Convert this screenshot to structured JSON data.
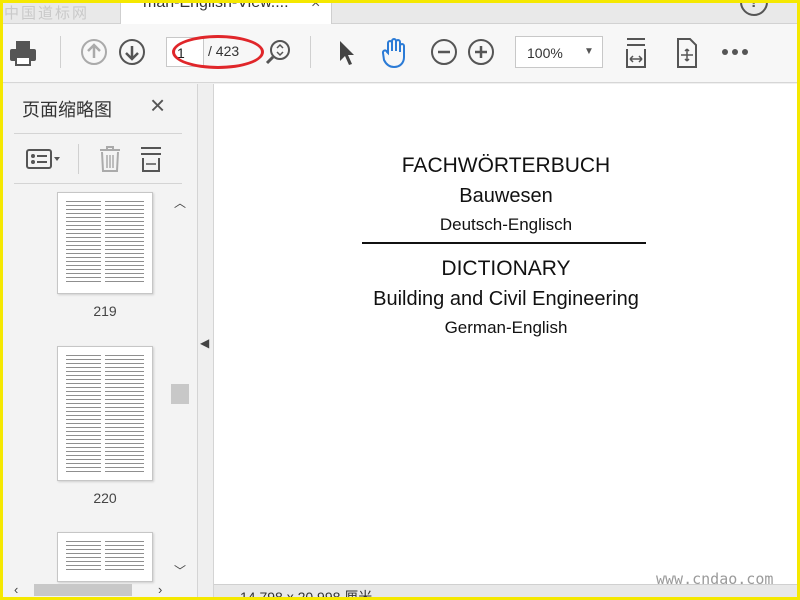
{
  "watermarks": {
    "top": "中国道标网",
    "bottom": "www.cndao.com"
  },
  "tab": {
    "title": "man-English-View....",
    "close": "×"
  },
  "help_icon": "?",
  "toolbar": {
    "page_current": "1",
    "page_total": "/ 423",
    "zoom": "100%",
    "icons": [
      "print-icon",
      "page-up-icon",
      "page-down-icon",
      "zoom-page-icon",
      "select-arrow-icon",
      "hand-tool-icon",
      "zoom-out-icon",
      "zoom-in-icon",
      "fit-width-icon",
      "rotate-fit-icon",
      "more-icon"
    ]
  },
  "thumbnails_panel": {
    "title": "页面缩略图",
    "close": "×",
    "thumbnails": [
      {
        "label": "219"
      },
      {
        "label": "220"
      },
      {
        "label": ""
      }
    ]
  },
  "document": {
    "line1": "FACHWÖRTERBUCH",
    "line2": "Bauwesen",
    "line3": "Deutsch-Englisch",
    "line4": "DICTIONARY",
    "line5": "Building and Civil Engineering",
    "line6": "German-English"
  },
  "status": {
    "page_size": "14,798 x 20,998 厘米"
  },
  "colors": {
    "accent_blue": "#2b7bd6",
    "highlight_red": "#e0262a",
    "frame_yellow": "#f5e800"
  }
}
